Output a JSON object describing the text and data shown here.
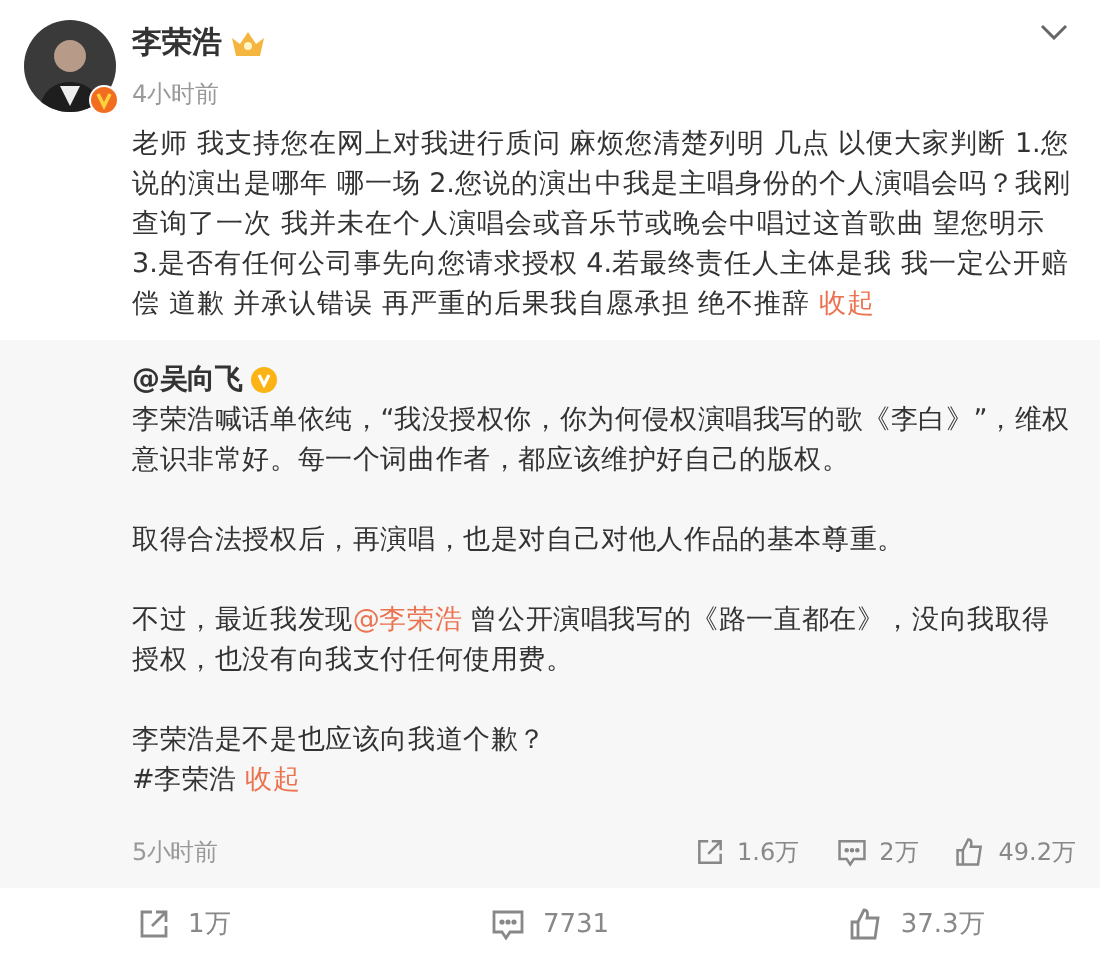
{
  "post": {
    "author": "李荣浩",
    "time": "4小时前",
    "text": "老师 我支持您在网上对我进行质问 麻烦您清楚列明 几点  以便大家判断 1.您说的演出是哪年 哪一场  2.您说的演出中我是主唱身份的个人演唱会吗？我刚查询了一次 我并未在个人演唱会或音乐节或晚会中唱过这首歌曲 望您明示 3.是否有任何公司事先向您请求授权  4.若最终责任人主体是我 我一定公开赔偿 道歉 并承认错误 再严重的后果我自愿承担 绝不推辞",
    "collapse": "收起"
  },
  "repost": {
    "author": "@吴向飞",
    "paragraphs": [
      {
        "text": "李荣浩喊话单依纯，“我没授权你，你为何侵权演唱我写的歌《李白》”，维权意识非常好。每一个词曲作者，都应该维护好自己的版权。"
      },
      {
        "text": "取得合法授权后，再演唱，也是对自己对他人作品的基本尊重。"
      },
      {
        "text": "不过，最近我发现",
        "mention": "@李荣浩",
        "text_after": " 曾公开演唱我写的《路一直都在》，没向我取得授权，也没有向我支付任何使用费。"
      },
      {
        "text": "李荣浩是不是也应该向我道个歉？"
      }
    ],
    "hashtag": "#李荣浩",
    "collapse": "收起",
    "time": "5小时前",
    "stats": [
      {
        "kind": "share",
        "count": "1.6万"
      },
      {
        "kind": "comment",
        "count": "2万"
      },
      {
        "kind": "like",
        "count": "49.2万"
      }
    ]
  },
  "actions": [
    {
      "kind": "share",
      "count": "1万"
    },
    {
      "kind": "comment",
      "count": "7731"
    },
    {
      "kind": "like",
      "count": "37.3万"
    }
  ]
}
